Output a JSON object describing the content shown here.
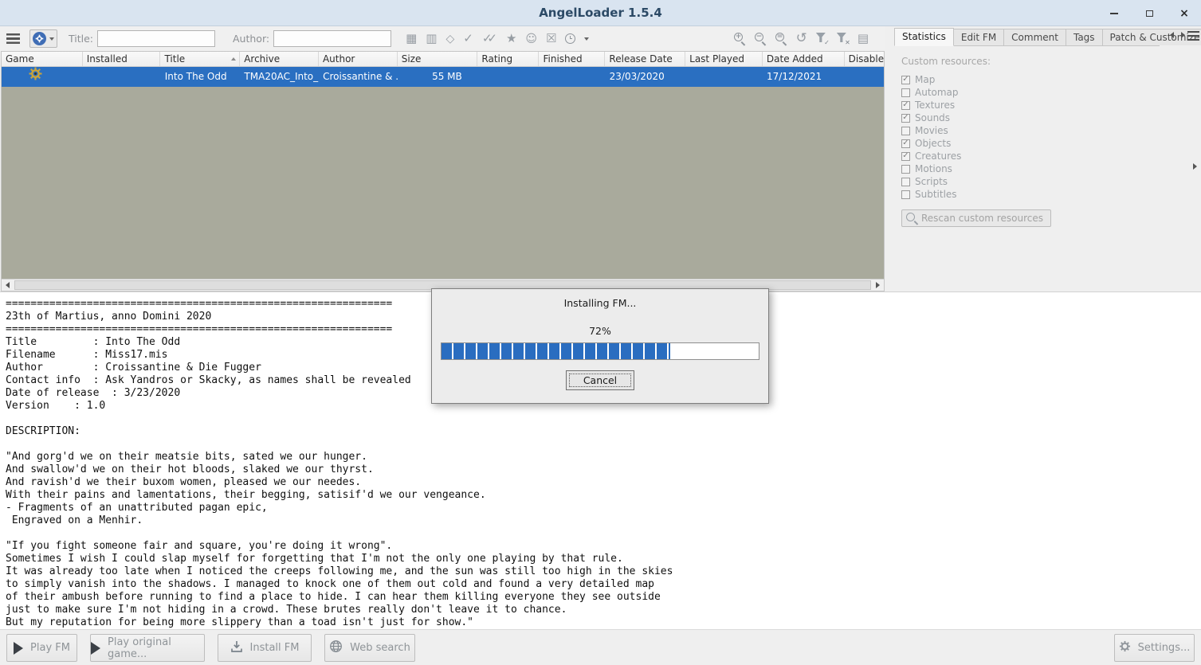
{
  "window": {
    "title": "AngelLoader 1.5.4"
  },
  "toolbar": {
    "title_label": "Title:",
    "author_label": "Author:",
    "title_value": "",
    "author_value": ""
  },
  "table": {
    "columns": [
      "Game",
      "Installed",
      "Title",
      "Archive",
      "Author",
      "Size",
      "Rating",
      "Finished",
      "Release Date",
      "Last Played",
      "Date Added",
      "Disable"
    ],
    "row": {
      "game_icon": "thief-gear-icon",
      "installed": "",
      "title": "Into The Odd",
      "archive": "TMA20AC_Into_...",
      "author": "Croissantine & ...",
      "size": "55 MB",
      "rating": "",
      "finished": "",
      "release_date": "23/03/2020",
      "last_played": "",
      "date_added": "17/12/2021",
      "disabled_mods": ""
    }
  },
  "right_panel": {
    "tabs": [
      {
        "label": "Statistics",
        "selected": true
      },
      {
        "label": "Edit FM",
        "selected": false
      },
      {
        "label": "Comment",
        "selected": false
      },
      {
        "label": "Tags",
        "selected": false
      },
      {
        "label": "Patch & Customize",
        "selected": false
      }
    ],
    "custom_resources_label": "Custom resources:",
    "resources": [
      {
        "label": "Map",
        "checked": true
      },
      {
        "label": "Automap",
        "checked": false
      },
      {
        "label": "Textures",
        "checked": true
      },
      {
        "label": "Sounds",
        "checked": true
      },
      {
        "label": "Movies",
        "checked": false
      },
      {
        "label": "Objects",
        "checked": true
      },
      {
        "label": "Creatures",
        "checked": true
      },
      {
        "label": "Motions",
        "checked": false
      },
      {
        "label": "Scripts",
        "checked": false
      },
      {
        "label": "Subtitles",
        "checked": false
      }
    ],
    "rescan_button_label": "Rescan custom resources"
  },
  "readme": {
    "text": "==============================================================\n23th of Martius, anno Domini 2020\n==============================================================\nTitle         : Into The Odd\nFilename      : Miss17.mis\nAuthor        : Croissantine & Die Fugger\nContact info  : Ask Yandros or Skacky, as names shall be revealed\nDate of release  : 3/23/2020\nVersion    : 1.0\n\nDESCRIPTION:\n\n\"And gorg'd we on their meatsie bits, sated we our hunger.\nAnd swallow'd we on their hot bloods, slaked we our thyrst.\nAnd ravish'd we their buxom women, pleased we our needes.\nWith their pains and lamentations, their begging, satisif'd we our vengeance.\n- Fragments of an unattributed pagan epic,\n Engraved on a Menhir.\n\n\"If you fight someone fair and square, you're doing it wrong\".\nSometimes I wish I could slap myself for forgetting that I'm not the only one playing by that rule.\nIt was already too late when I noticed the creeps following me, and the sun was still too high in the skies\nto simply vanish into the shadows. I managed to knock one of them out cold and found a very detailed map\nof their ambush before running to find a place to hide. I can hear them killing everyone they see outside\njust to make sure I'm not hiding in a crowd. These brutes really don't leave it to chance.\nBut my reputation for being more slippery than a toad isn't just for show.\""
  },
  "dialog": {
    "title": "Installing FM...",
    "percent_label": "72%",
    "progress": 72,
    "cancel_label": "Cancel"
  },
  "bottom_bar": {
    "play_fm_label": "Play FM",
    "play_original_label": "Play original game...",
    "install_fm_label": "Install FM",
    "web_search_label": "Web search",
    "settings_label": "Settings..."
  },
  "colors": {
    "selection_blue": "#2a6fc1",
    "titlebar_bg": "#d9e4f0",
    "empty_table_bg": "#a9aa9c",
    "progress_blue": "#2a6dc0"
  }
}
